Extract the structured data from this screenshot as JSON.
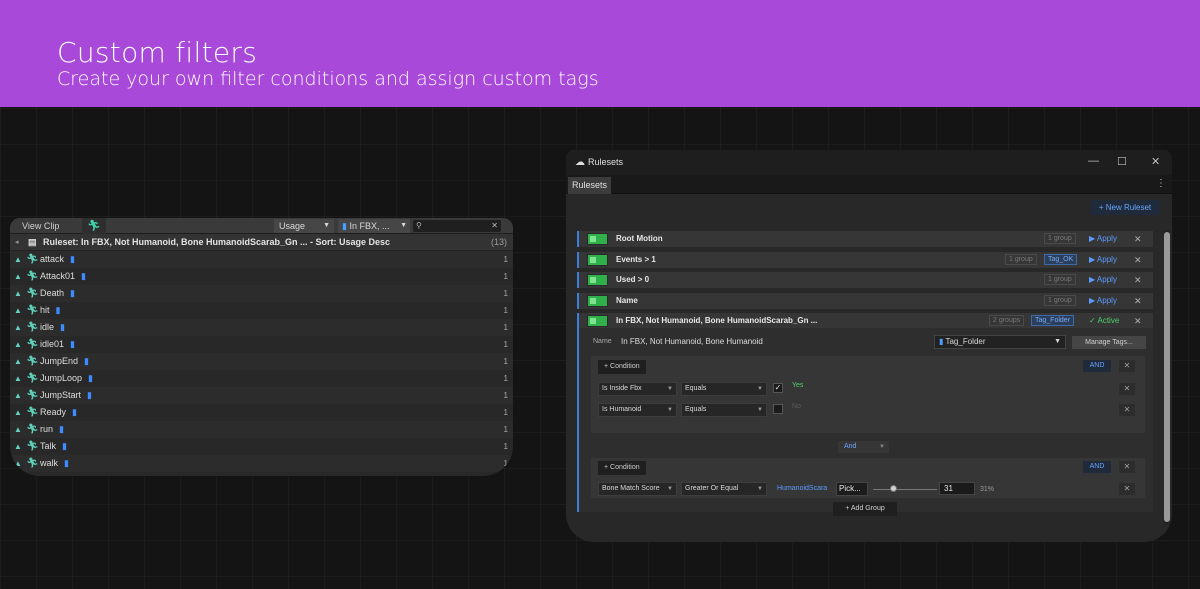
{
  "banner": {
    "title": "Custom filters",
    "subtitle": "Create your own filter conditions and assign custom tags",
    "color": "#a849d9"
  },
  "clip_panel": {
    "toolbar": {
      "title": "View Clip",
      "usage_select": "Usage",
      "filter_select": "In FBX, ...",
      "search_value": ""
    },
    "ruleset": {
      "label": "Ruleset: In FBX, Not Humanoid, Bone HumanoidScarab_Gn ... - Sort: Usage Desc",
      "count": "(13)"
    },
    "items": [
      {
        "name": "attack",
        "count": "1"
      },
      {
        "name": "Attack01",
        "count": "1"
      },
      {
        "name": "Death",
        "count": "1"
      },
      {
        "name": "hit",
        "count": "1"
      },
      {
        "name": "idle",
        "count": "1"
      },
      {
        "name": "idle01",
        "count": "1"
      },
      {
        "name": "JumpEnd",
        "count": "1"
      },
      {
        "name": "JumpLoop",
        "count": "1"
      },
      {
        "name": "JumpStart",
        "count": "1"
      },
      {
        "name": "Ready",
        "count": "1"
      },
      {
        "name": "run",
        "count": "1"
      },
      {
        "name": "Talk",
        "count": "1"
      },
      {
        "name": "walk",
        "count": "1"
      }
    ]
  },
  "rulesets_window": {
    "title": "Rulesets",
    "tab": "Rulesets",
    "new_ruleset": "+ New Ruleset",
    "rules": [
      {
        "name": "Root Motion",
        "groups": "1 group",
        "tag": "",
        "action": "▶ Apply"
      },
      {
        "name": "Events > 1",
        "groups": "1 group",
        "tag": "Tag_OK",
        "action": "▶ Apply"
      },
      {
        "name": "Used > 0",
        "groups": "1 group",
        "tag": "",
        "action": "▶ Apply"
      },
      {
        "name": "Name",
        "groups": "1 group",
        "tag": "",
        "action": "▶ Apply"
      },
      {
        "name": "In FBX, Not Humanoid, Bone HumanoidScarab_Gn ...",
        "groups": "2 groups",
        "tag": "Tag_Folder",
        "action": "✓ Active"
      }
    ],
    "editor": {
      "name_label": "Name",
      "name_value": "In FBX, Not Humanoid, Bone Humanoid",
      "folder_select": "Tag_Folder",
      "manage_tags": "Manage Tags...",
      "group1": {
        "condition_btn": "+ Condition",
        "and_btn": "AND",
        "rows": [
          {
            "field": "Is Inside Fbx",
            "op": "Equals",
            "checked": true,
            "value_text": "Yes"
          },
          {
            "field": "Is Humanoid",
            "op": "Equals",
            "checked": false,
            "value_text": "No"
          }
        ]
      },
      "combinator": "And",
      "group2": {
        "condition_btn": "+ Condition",
        "and_btn": "AND",
        "row": {
          "field": "Bone Match Score",
          "op": "Greater Or Equal",
          "link": "HumanoidScara",
          "pick": "Pick...",
          "number": "31",
          "percent": "31%",
          "slider_level": 0.31
        }
      },
      "add_group": "+ Add Group"
    }
  }
}
